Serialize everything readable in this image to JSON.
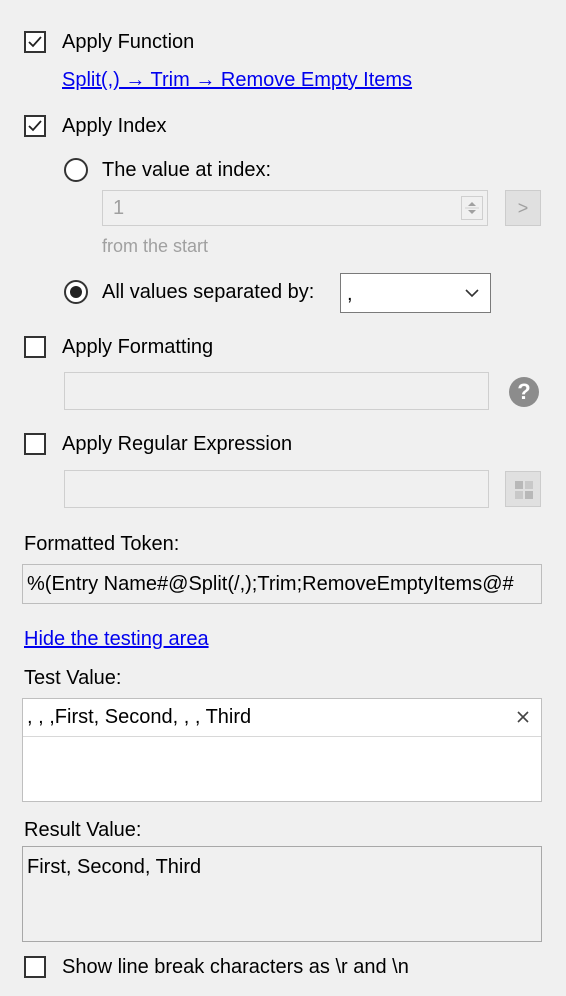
{
  "apply_function": {
    "label": "Apply Function",
    "checked": true,
    "chain": "Split(,) → Trim → Remove Empty Items"
  },
  "apply_index": {
    "label": "Apply Index",
    "checked": true,
    "value_at_index": {
      "label": "The value at index:",
      "selected": false,
      "value": "1",
      "direction": "from the  start",
      "go_button": ">"
    },
    "all_values": {
      "label": "All values separated by:",
      "selected": true,
      "separator": ","
    }
  },
  "apply_formatting": {
    "label": "Apply Formatting",
    "checked": false,
    "value": "",
    "help_icon": "question-circle-icon"
  },
  "apply_regex": {
    "label": "Apply Regular Expression",
    "checked": false,
    "value": "",
    "picker_icon": "regex-palette-icon"
  },
  "formatted_token": {
    "label": "Formatted Token:",
    "value": "%(Entry Name#@Split(/,);Trim;RemoveEmptyItems@#"
  },
  "testing": {
    "toggle_link": "Hide the testing area",
    "test_value_label": "Test Value:",
    "test_value": ", , ,First, Second, , , Third",
    "clear_icon": "close-icon",
    "result_label": "Result Value:",
    "result_value": "First, Second, Third",
    "show_line_breaks": {
      "label": "Show line break characters as \\r and \\n",
      "checked": false
    }
  }
}
